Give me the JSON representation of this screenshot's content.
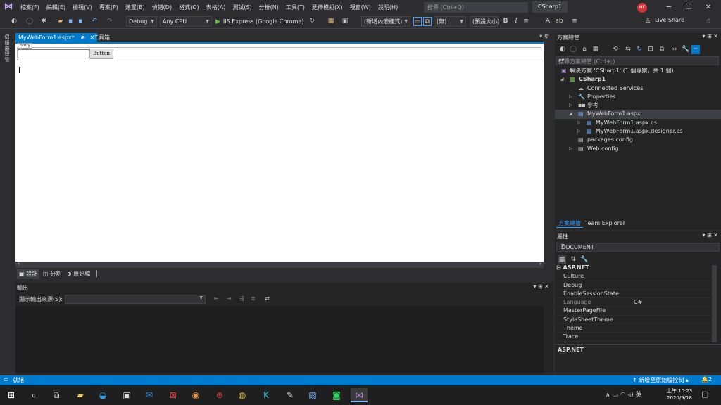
{
  "menu": {
    "items": [
      "檔案(F)",
      "編輯(E)",
      "檢視(V)",
      "專案(P)",
      "建置(B)",
      "偵錯(D)",
      "格式(O)",
      "表格(A)",
      "測試(S)",
      "分析(N)",
      "工具(T)",
      "延伸模組(X)",
      "視窗(W)",
      "說明(H)"
    ],
    "search_placeholder": "搜尋 (Ctrl+Q)",
    "solution_title": "CSharp1",
    "avatar_initials": "HF"
  },
  "toolbar": {
    "config": "Debug",
    "platform": "Any CPU",
    "run_label": "IIS Express (Google Chrome)",
    "block_format": "(新增內嵌樣式)",
    "style_target": "(無)",
    "font_name": "(預設大小)",
    "live_share": "Live Share"
  },
  "left_strip": {
    "label": "伺服器總管"
  },
  "editor": {
    "tabs": [
      {
        "label": "MyWebForm1.aspx*",
        "pin": "⊕",
        "close": "✕"
      },
      {
        "label": "工具箱"
      }
    ],
    "body_tag": "body",
    "button_label": "Button",
    "view_modes": [
      "設計",
      "分割",
      "原始檔"
    ]
  },
  "output": {
    "title": "輸出",
    "source_label": "顯示輸出來源(S):"
  },
  "solution_explorer": {
    "title": "方案總管",
    "search_placeholder": "搜尋方案總管 (Ctrl+;)",
    "tree": [
      {
        "label": "解決方案 'CSharp1' (1 個專案，共 1 個)",
        "level": 0,
        "expander": "",
        "icon": "▣"
      },
      {
        "label": "CSharp1",
        "level": 1,
        "expander": "◢",
        "icon": "▩"
      },
      {
        "label": "Connected Services",
        "level": 2,
        "expander": "",
        "icon": "☁"
      },
      {
        "label": "Properties",
        "level": 2,
        "expander": "▷",
        "icon": "🔧"
      },
      {
        "label": "參考",
        "level": 2,
        "expander": "▷",
        "icon": "▪▪"
      },
      {
        "label": "MyWebForm1.aspx",
        "level": 2,
        "expander": "◢",
        "icon": "▤",
        "selected": true
      },
      {
        "label": "MyWebForm1.aspx.cs",
        "level": 3,
        "expander": "▷",
        "icon": "▤"
      },
      {
        "label": "MyWebForm1.aspx.designer.cs",
        "level": 3,
        "expander": "▷",
        "icon": "▤"
      },
      {
        "label": "packages.config",
        "level": 2,
        "expander": "",
        "icon": "▤"
      },
      {
        "label": "Web.config",
        "level": 2,
        "expander": "▷",
        "icon": "▤"
      }
    ],
    "tabs": [
      "方案總管",
      "Team Explorer"
    ]
  },
  "properties": {
    "title": "屬性",
    "object": "DOCUMENT",
    "category": "ASP.NET",
    "rows": [
      {
        "name": "Culture",
        "value": ""
      },
      {
        "name": "Debug",
        "value": ""
      },
      {
        "name": "EnableSessionState",
        "value": ""
      },
      {
        "name": "Language",
        "value": "C#",
        "dim": true
      },
      {
        "name": "MasterPageFile",
        "value": ""
      },
      {
        "name": "StyleSheetTheme",
        "value": ""
      },
      {
        "name": "Theme",
        "value": ""
      },
      {
        "name": "Trace",
        "value": ""
      }
    ],
    "description_title": "ASP.NET"
  },
  "status": {
    "ready": "就緒",
    "source_control": "新增至原始檔控制",
    "notification_count": "2"
  },
  "taskbar": {
    "clock_time": "上午 10:23",
    "clock_date": "2020/9/18",
    "ime": "英"
  }
}
